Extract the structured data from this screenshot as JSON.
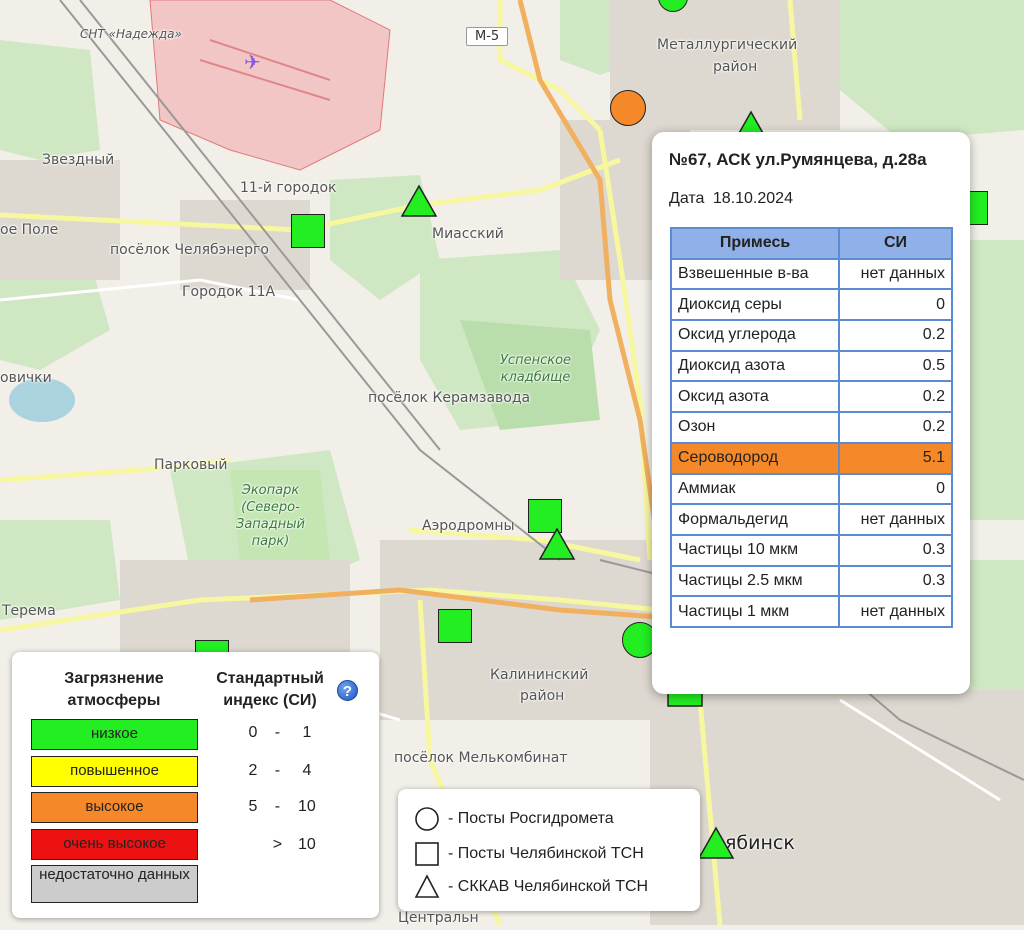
{
  "map": {
    "labels": {
      "snt": "СНТ «Надежда»",
      "metallurg": "Металлургический",
      "rayon1": "район",
      "zvezdny": "Звездный",
      "gorodok11": "11-й городок",
      "miassky": "Миасский",
      "chelyabenergo": "посёлок Челябэнерго",
      "gorodok11a": "Городок 11А",
      "oye_pole": "ое Поле",
      "uspenskoe1": "Успенское",
      "uspenskoe2": "кладбище",
      "keramzavod": "посёлок Керамзавода",
      "ovichki": "овички",
      "parkovy": "Парковый",
      "ekopark1": "Экопарк",
      "ekopark2": "(Северо-",
      "ekopark3": "Западный",
      "ekopark4": "парк)",
      "aerodromny": "Аэродромны",
      "terema": "Терема",
      "kalininsky": "Калининский",
      "rayon2": "район",
      "melkombinat": "посёлок Мелькомбинат",
      "chelyabinsk": "ябинск",
      "centralny": "Центральн"
    },
    "road_shield": "М-5",
    "colors": {
      "low": "#22ee22",
      "elevated": "#ffff00",
      "high": "#f5892a",
      "very_high": "#ee1111",
      "no_data": "#cccccc"
    }
  },
  "popup": {
    "title": "№67, АСК ул.Румянцева, д.28а",
    "date_label": "Дата",
    "date_value": "18.10.2024",
    "col_pollutant": "Примесь",
    "col_si": "СИ",
    "rows": [
      {
        "name": "Взвешенные в-ва",
        "value": "нет данных"
      },
      {
        "name": "Диоксид серы",
        "value": "0"
      },
      {
        "name": "Оксид углерода",
        "value": "0.2"
      },
      {
        "name": "Диоксид азота",
        "value": "0.5"
      },
      {
        "name": "Оксид азота",
        "value": "0.2"
      },
      {
        "name": "Озон",
        "value": "0.2"
      },
      {
        "name": "Сероводород",
        "value": "5.1"
      },
      {
        "name": "Аммиак",
        "value": "0"
      },
      {
        "name": "Формальдегид",
        "value": "нет данных"
      },
      {
        "name": "Частицы 10 мкм",
        "value": "0.3"
      },
      {
        "name": "Частицы 2.5 мкм",
        "value": "0.3"
      },
      {
        "name": "Частицы 1 мкм",
        "value": "нет данных"
      }
    ]
  },
  "legend": {
    "header_pollution": "Загрязнение атмосферы",
    "header_index": "Стандартный индекс (СИ)",
    "help": "?",
    "levels": [
      {
        "label": "низкое",
        "from": "0",
        "sep": "-",
        "to": "1"
      },
      {
        "label": "повышенное",
        "from": "2",
        "sep": "-",
        "to": "4"
      },
      {
        "label": "высокое",
        "from": "5",
        "sep": "-",
        "to": "10"
      },
      {
        "label": "очень высокое",
        "from": "",
        "sep": ">",
        "to": "10"
      },
      {
        "label": "недостаточно данных",
        "from": "",
        "sep": "",
        "to": ""
      }
    ]
  },
  "station_legend": {
    "circle": "- Посты Росгидромета",
    "square": "- Посты Челябинской ТСН",
    "triangle": "- СККАВ Челябинской ТСН"
  }
}
